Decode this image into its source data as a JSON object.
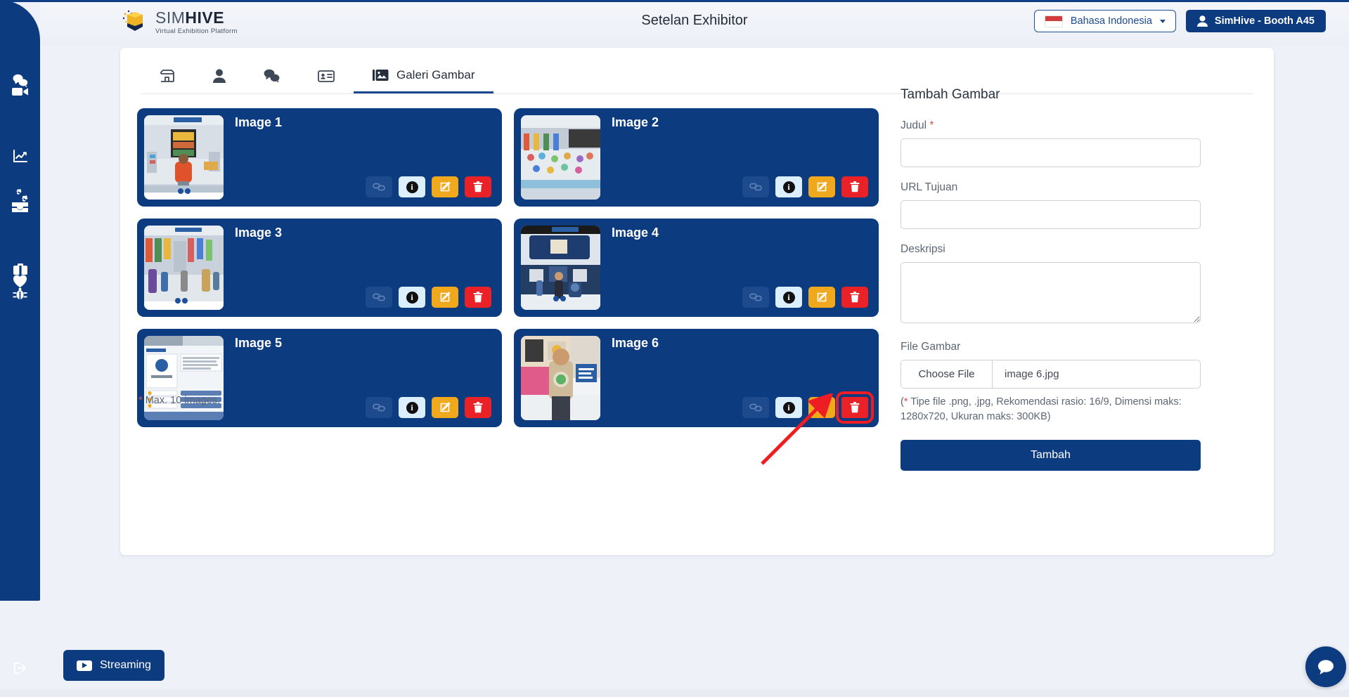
{
  "header": {
    "page_title": "Setelan Exhibitor",
    "logo": {
      "name_light": "SIM",
      "name_bold": "HIVE",
      "tagline": "Virtual Exhibition Platform",
      "icon": "hive-cube-logo"
    },
    "language_button": {
      "label": "Bahasa Indonesia",
      "flag": "indonesia-flag",
      "caret": "chevron-down-icon"
    },
    "user_button": {
      "label": "SimHive - Booth A45",
      "icon": "user-icon"
    }
  },
  "sidebar": {
    "items": [
      {
        "icon": "chat-bubbles-icon",
        "name": "chat"
      },
      {
        "icon": "video-camera-icon",
        "name": "video"
      },
      {
        "icon": "analytics-chart-icon",
        "name": "analytics"
      },
      {
        "icon": "gears-settings-icon",
        "name": "settings"
      },
      {
        "icon": "inbox-archive-icon",
        "name": "inbox"
      },
      {
        "icon": "briefcase-icon",
        "name": "briefcase"
      },
      {
        "icon": "heart-icon",
        "name": "favorites"
      },
      {
        "icon": "bug-icon",
        "name": "report-bug"
      },
      {
        "icon": "logout-icon",
        "name": "logout"
      }
    ]
  },
  "tabs": [
    {
      "label": "",
      "icon": "booth-store-icon",
      "name": "tab-booth",
      "active": false
    },
    {
      "label": "",
      "icon": "person-icon",
      "name": "tab-profile",
      "active": false
    },
    {
      "label": "",
      "icon": "chat-bubbles-icon",
      "name": "tab-chat",
      "active": false
    },
    {
      "label": "",
      "icon": "id-card-icon",
      "name": "tab-namecard",
      "active": false
    },
    {
      "label": "Galeri Gambar",
      "icon": "image-gallery-icon",
      "name": "tab-gallery",
      "active": true
    }
  ],
  "gallery": {
    "max_note_star": "*",
    "max_note": "Max. 10 images.",
    "actions": {
      "link": "link-icon",
      "info": "info-icon",
      "edit": "edit-pencil-icon",
      "delete": "trash-delete-icon"
    },
    "items": [
      {
        "title": "Image 1",
        "thumb": "expo-hall-avatar-orange",
        "highlighted": false
      },
      {
        "title": "Image 2",
        "thumb": "expo-hall-crowd",
        "highlighted": false
      },
      {
        "title": "Image 3",
        "thumb": "expo-street-flags",
        "highlighted": false
      },
      {
        "title": "Image 4",
        "thumb": "virtual-booth-screen",
        "highlighted": false
      },
      {
        "title": "Image 5",
        "thumb": "landing-page-mockup",
        "highlighted": false
      },
      {
        "title": "Image 6",
        "thumb": "person-banner-photo",
        "highlighted": true
      }
    ]
  },
  "form": {
    "heading": "Tambah Gambar",
    "title_label": "Judul",
    "title_required": "*",
    "title_value": "",
    "url_label": "URL Tujuan",
    "url_value": "",
    "description_label": "Deskripsi",
    "description_value": "",
    "file_label": "File Gambar",
    "file_choose_button": "Choose File",
    "file_name": "image 6.jpg",
    "hint_star": "*",
    "hint_text": " Tipe file .png, .jpg, Rekomendasi rasio: 16/9, Dimensi maks: 1280x720, Ukuran maks: 300KB)",
    "hint_open_paren": "(",
    "submit_label": "Tambah"
  },
  "footer": {
    "streaming_label": "Streaming",
    "streaming_icon": "youtube-play-icon",
    "chat_fab_icon": "chat-bubble-icon"
  },
  "annotation": {
    "color": "#ee1c23",
    "target": "delete-button-image-6"
  }
}
